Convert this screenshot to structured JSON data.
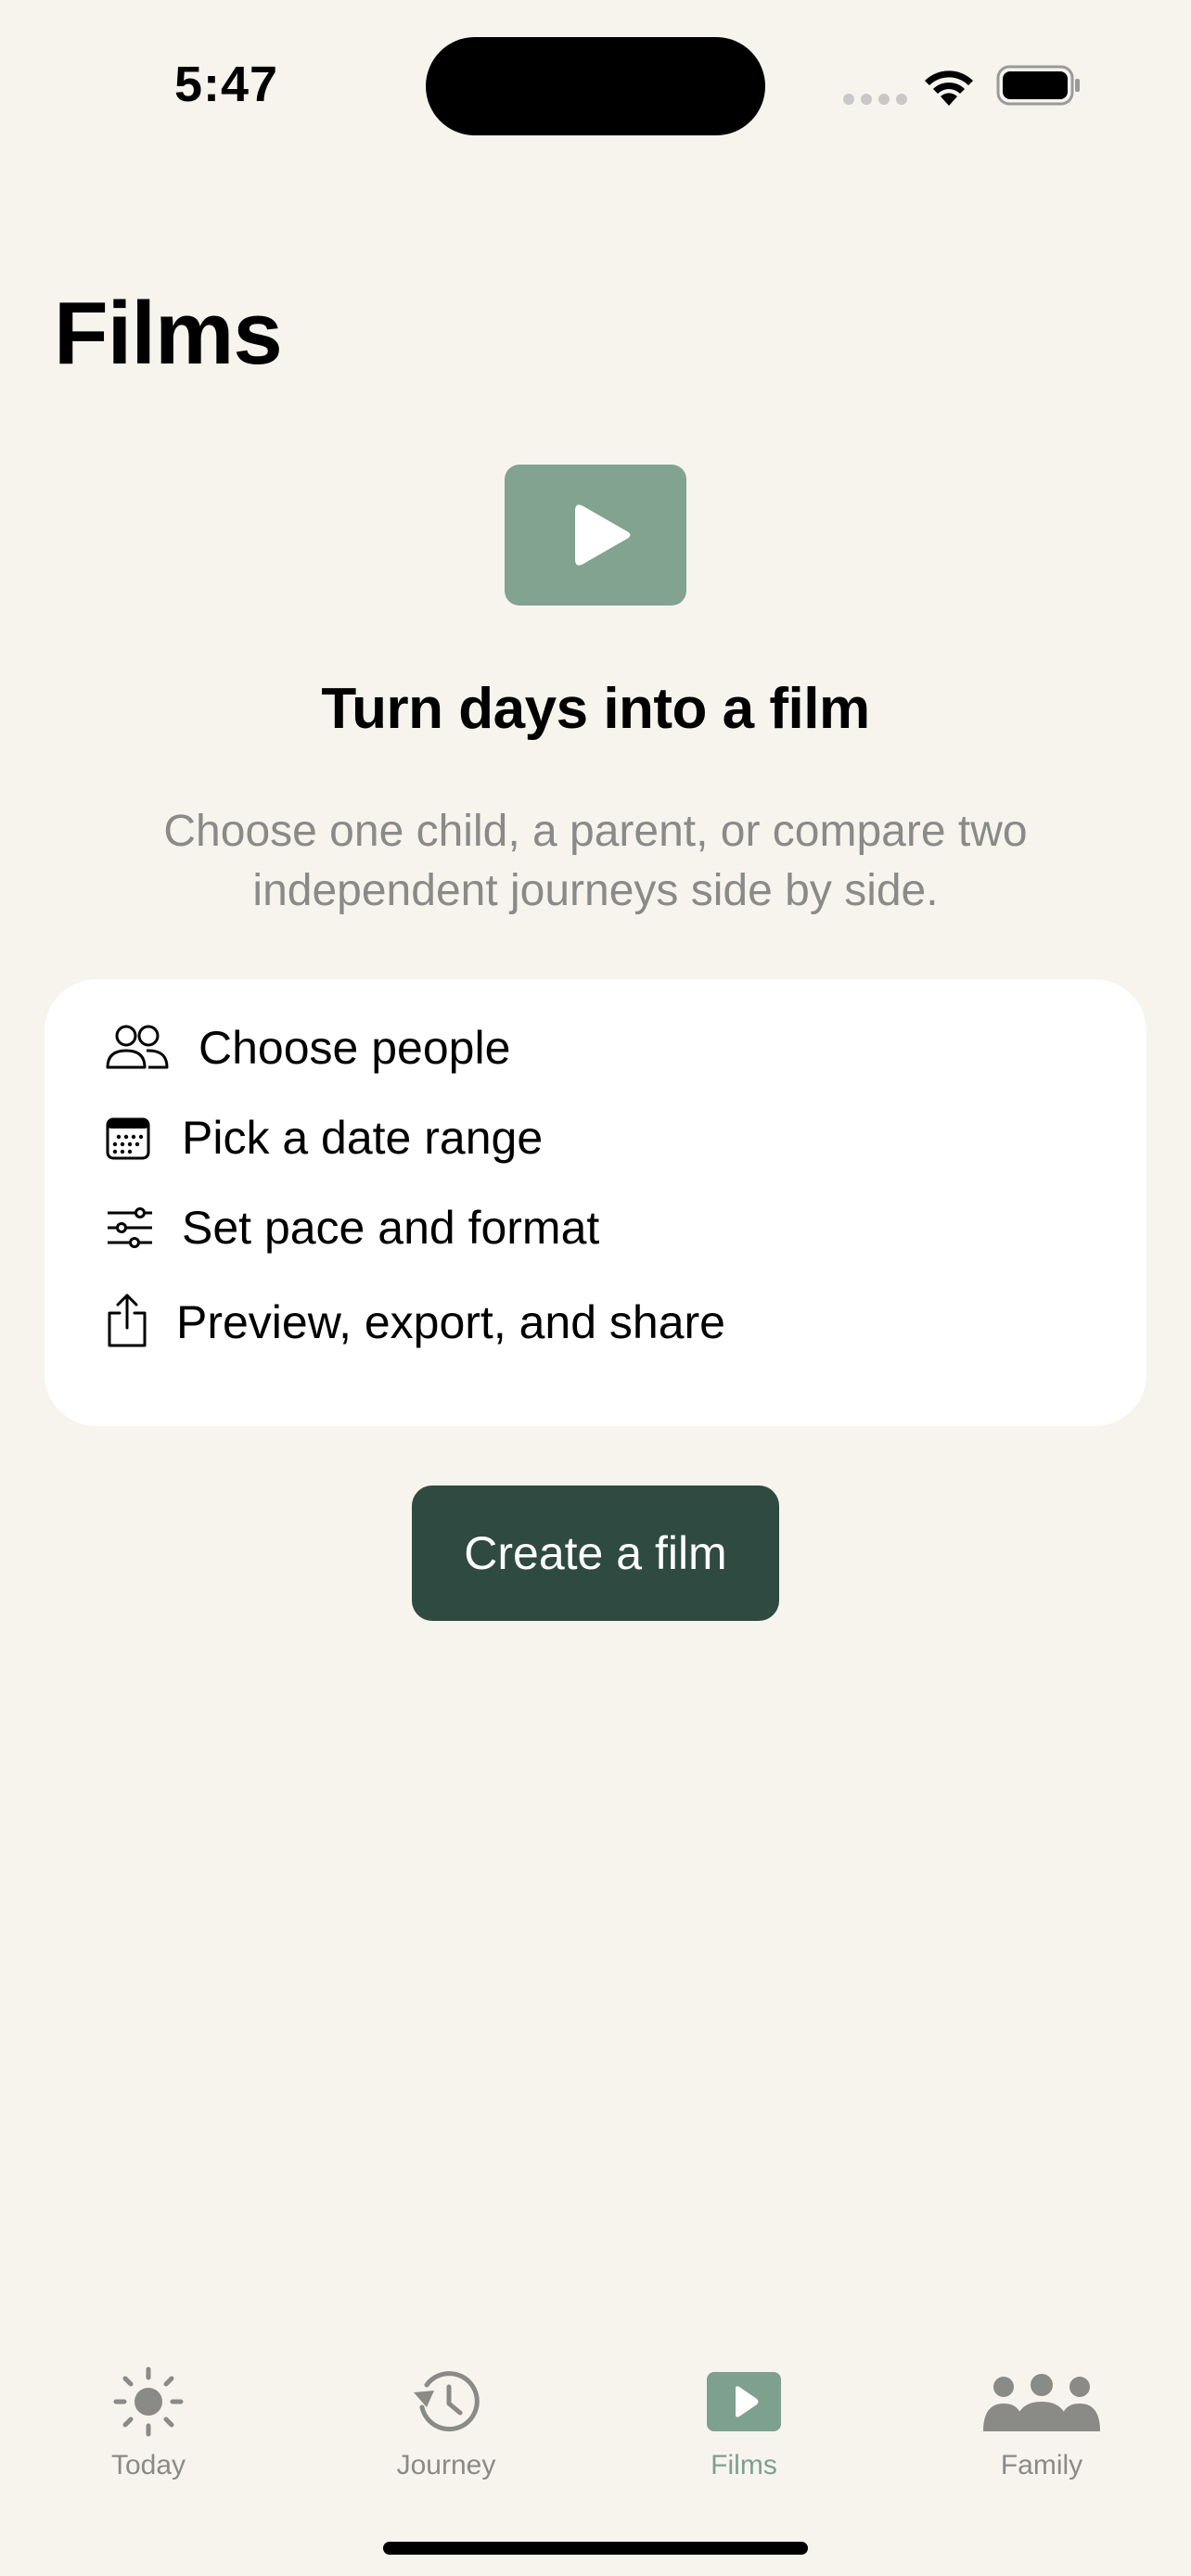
{
  "status_bar": {
    "time": "5:47",
    "icons": [
      "signal-dots-icon",
      "wifi-icon",
      "battery-icon"
    ]
  },
  "page": {
    "title": "Films"
  },
  "hero": {
    "icon": "play-icon",
    "heading": "Turn days into a film",
    "subtitle": "Choose one child, a parent, or compare two independent journeys side by side."
  },
  "steps": [
    {
      "icon": "people-icon",
      "label": "Choose people"
    },
    {
      "icon": "calendar-icon",
      "label": "Pick a date range"
    },
    {
      "icon": "sliders-icon",
      "label": "Set pace and format"
    },
    {
      "icon": "share-icon",
      "label": "Preview, export, and share"
    }
  ],
  "primary_action": {
    "label": "Create a film"
  },
  "tab_bar": {
    "active": "Films",
    "items": [
      {
        "label": "Today",
        "icon": "sun-icon"
      },
      {
        "label": "Journey",
        "icon": "history-clock-icon"
      },
      {
        "label": "Films",
        "icon": "play-icon"
      },
      {
        "label": "Family",
        "icon": "family-icon"
      }
    ]
  },
  "colors": {
    "background": "#f7f4ee",
    "accent": "#81a390",
    "button": "#2f4a40",
    "inactive_tab": "#8a8a86",
    "active_tab": "#7ea08e"
  }
}
